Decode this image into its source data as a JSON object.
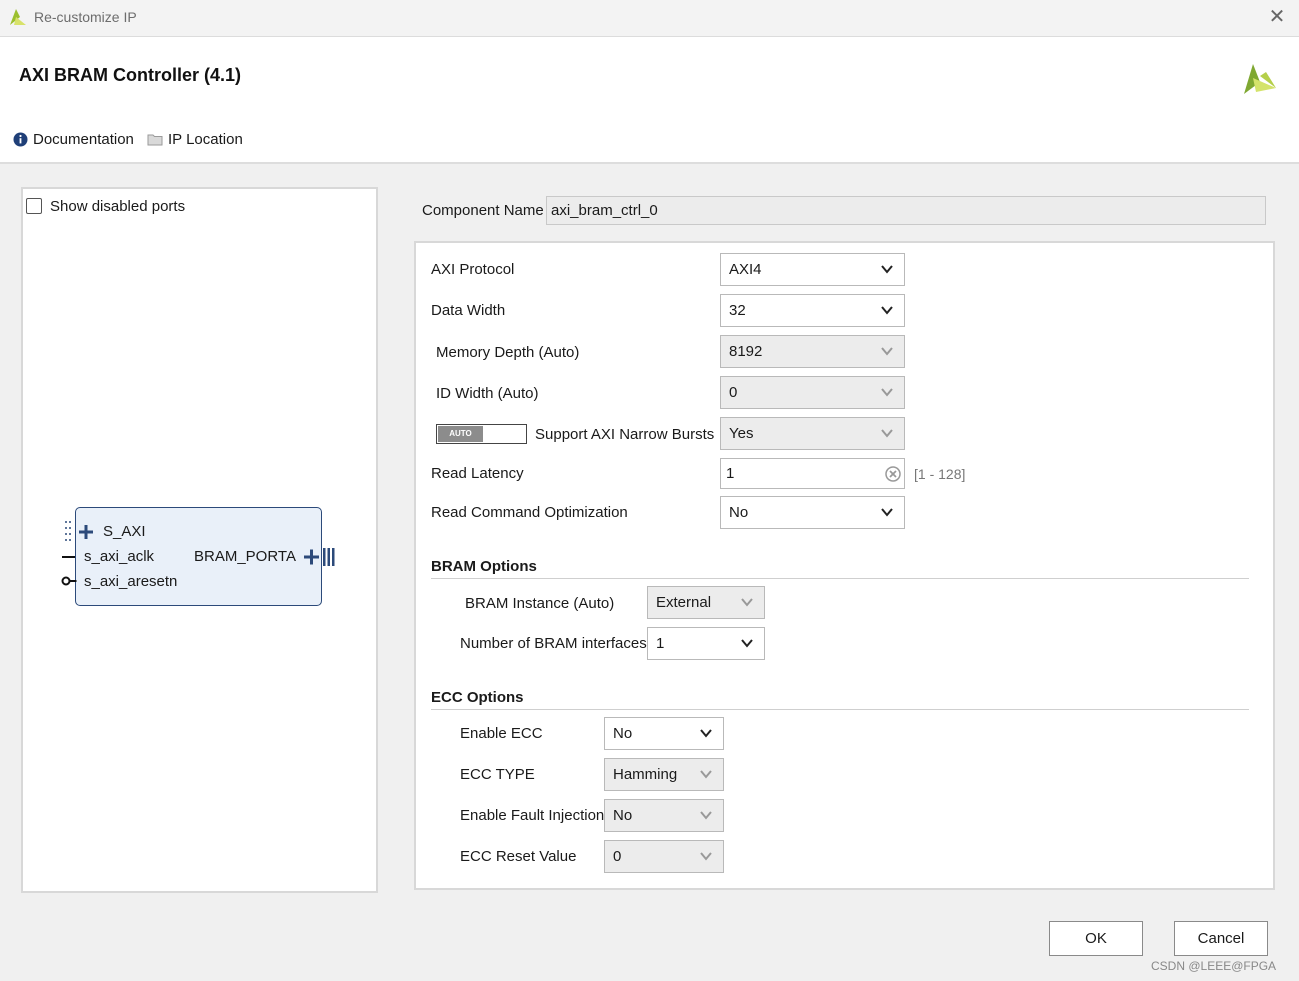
{
  "window": {
    "title": "Re-customize IP"
  },
  "header": {
    "ip_title": "AXI BRAM Controller (4.1)",
    "documentation": "Documentation",
    "ip_location": "IP Location"
  },
  "left_panel": {
    "show_disabled_ports": "Show disabled ports",
    "show_disabled_checked": false,
    "ports_left": [
      "S_AXI",
      "s_axi_aclk",
      "s_axi_aresetn"
    ],
    "ports_right": [
      "BRAM_PORTA"
    ]
  },
  "component": {
    "label": "Component Name",
    "value": "axi_bram_ctrl_0"
  },
  "params": {
    "axi_protocol": {
      "label": "AXI Protocol",
      "value": "AXI4"
    },
    "data_width": {
      "label": "Data Width",
      "value": "32"
    },
    "memory_depth": {
      "label": "Memory Depth (Auto)",
      "value": "8192"
    },
    "id_width": {
      "label": "ID Width (Auto)",
      "value": "0"
    },
    "narrow_bursts": {
      "auto_label": "AUTO",
      "label": "Support AXI Narrow Bursts",
      "value": "Yes"
    },
    "read_latency": {
      "label": "Read Latency",
      "value": "1",
      "range": "[1 - 128]"
    },
    "read_cmd_opt": {
      "label": "Read Command Optimization",
      "value": "No"
    }
  },
  "bram_options": {
    "title": "BRAM Options",
    "instance": {
      "label": "BRAM Instance (Auto)",
      "value": "External"
    },
    "interfaces": {
      "label": "Number of BRAM interfaces",
      "value": "1"
    }
  },
  "ecc_options": {
    "title": "ECC Options",
    "enable_ecc": {
      "label": "Enable ECC",
      "value": "No"
    },
    "ecc_type": {
      "label": "ECC TYPE",
      "value": "Hamming"
    },
    "fault_injection": {
      "label": "Enable Fault Injection",
      "value": "No"
    },
    "reset_value": {
      "label": "ECC Reset Value",
      "value": "0"
    }
  },
  "footer": {
    "ok": "OK",
    "cancel": "Cancel",
    "watermark": "CSDN @LEEE@FPGA"
  },
  "colors": {
    "accent": "#2c4a7a",
    "logo": "#9bbf2e",
    "block_fill": "#e9f0f9"
  }
}
